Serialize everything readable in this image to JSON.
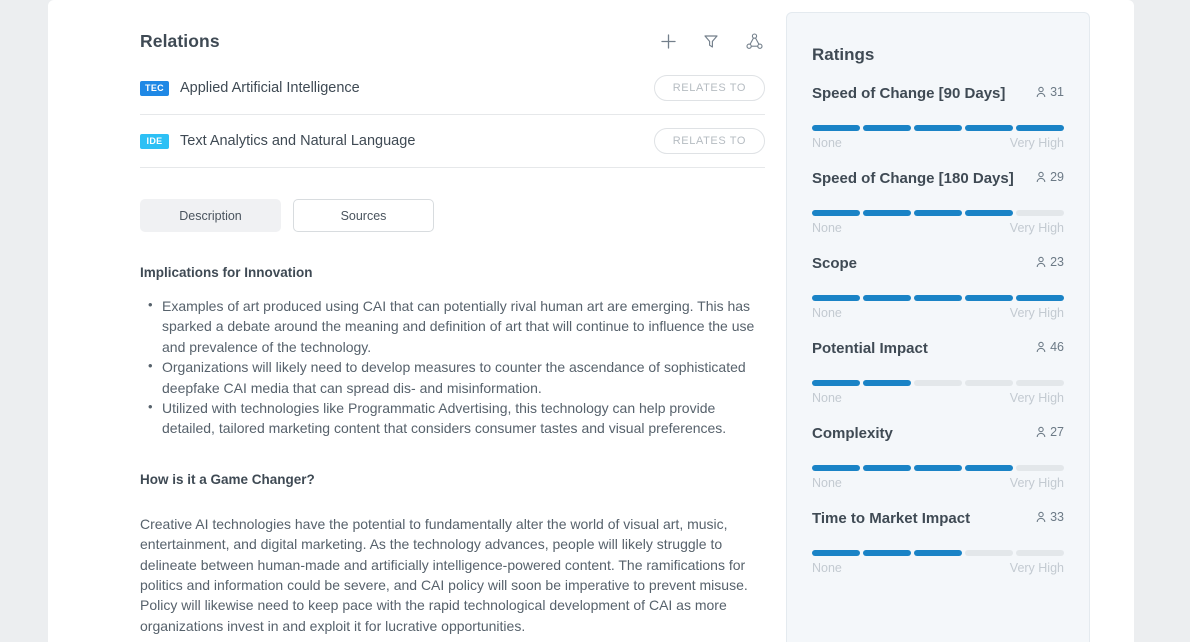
{
  "relations": {
    "title": "Relations",
    "actions": [
      {
        "name": "add-relation-button",
        "icon": "plus-icon"
      },
      {
        "name": "filter-relations-button",
        "icon": "filter-icon"
      },
      {
        "name": "relations-graph-button",
        "icon": "network-graph-icon"
      }
    ],
    "rows": [
      {
        "badge": "TEC",
        "badge_color": "#1f88e5",
        "name": "Applied Artificial Intelligence",
        "pill": "RELATES TO"
      },
      {
        "badge": "IDE",
        "badge_color": "#2dc0f5",
        "name": "Text Analytics and Natural Language",
        "pill": "RELATES TO"
      }
    ]
  },
  "tabs": [
    {
      "label": "Description",
      "active": true
    },
    {
      "label": "Sources",
      "active": false
    }
  ],
  "description": {
    "heading_1": "Implications for Innovation",
    "bullets": [
      "Examples of art produced using CAI that can potentially rival human art are emerging. This has sparked a debate around the meaning and definition of art that will continue to influence the use and prevalence of the technology.",
      "Organizations will likely need to develop measures to counter the ascendance of sophisticated deepfake CAI media that can spread dis- and misinformation.",
      "Utilized with technologies like Programmatic Advertising, this technology can help provide detailed, tailored marketing content that considers consumer tastes and visual preferences."
    ],
    "heading_2": "How is it a Game Changer?",
    "paragraph": "Creative AI technologies have the potential to fundamentally alter the world of visual art, music, entertainment, and digital marketing. As the technology advances, people will likely struggle to delineate between human-made and artificially intelligence-powered content. The ramifications for politics and information could be severe, and CAI policy will soon be imperative to prevent misuse. Policy will likewise need to keep pace with the rapid technological development of CAI as more organizations invest in and exploit it for lucrative opportunities."
  },
  "ratings": {
    "title": "Ratings",
    "scale_min": "None",
    "scale_max": "Very High",
    "segments_total": 5,
    "filled_color": "#1a83c6",
    "empty_color": "#e3e7ea",
    "items": [
      {
        "label": "Speed of Change [90 Days]",
        "count": "31",
        "filled": 5
      },
      {
        "label": "Speed of Change [180 Days]",
        "count": "29",
        "filled": 4
      },
      {
        "label": "Scope",
        "count": "23",
        "filled": 5
      },
      {
        "label": "Potential Impact",
        "count": "46",
        "filled": 2
      },
      {
        "label": "Complexity",
        "count": "27",
        "filled": 4
      },
      {
        "label": "Time to Market Impact",
        "count": "33",
        "filled": 3
      }
    ]
  }
}
